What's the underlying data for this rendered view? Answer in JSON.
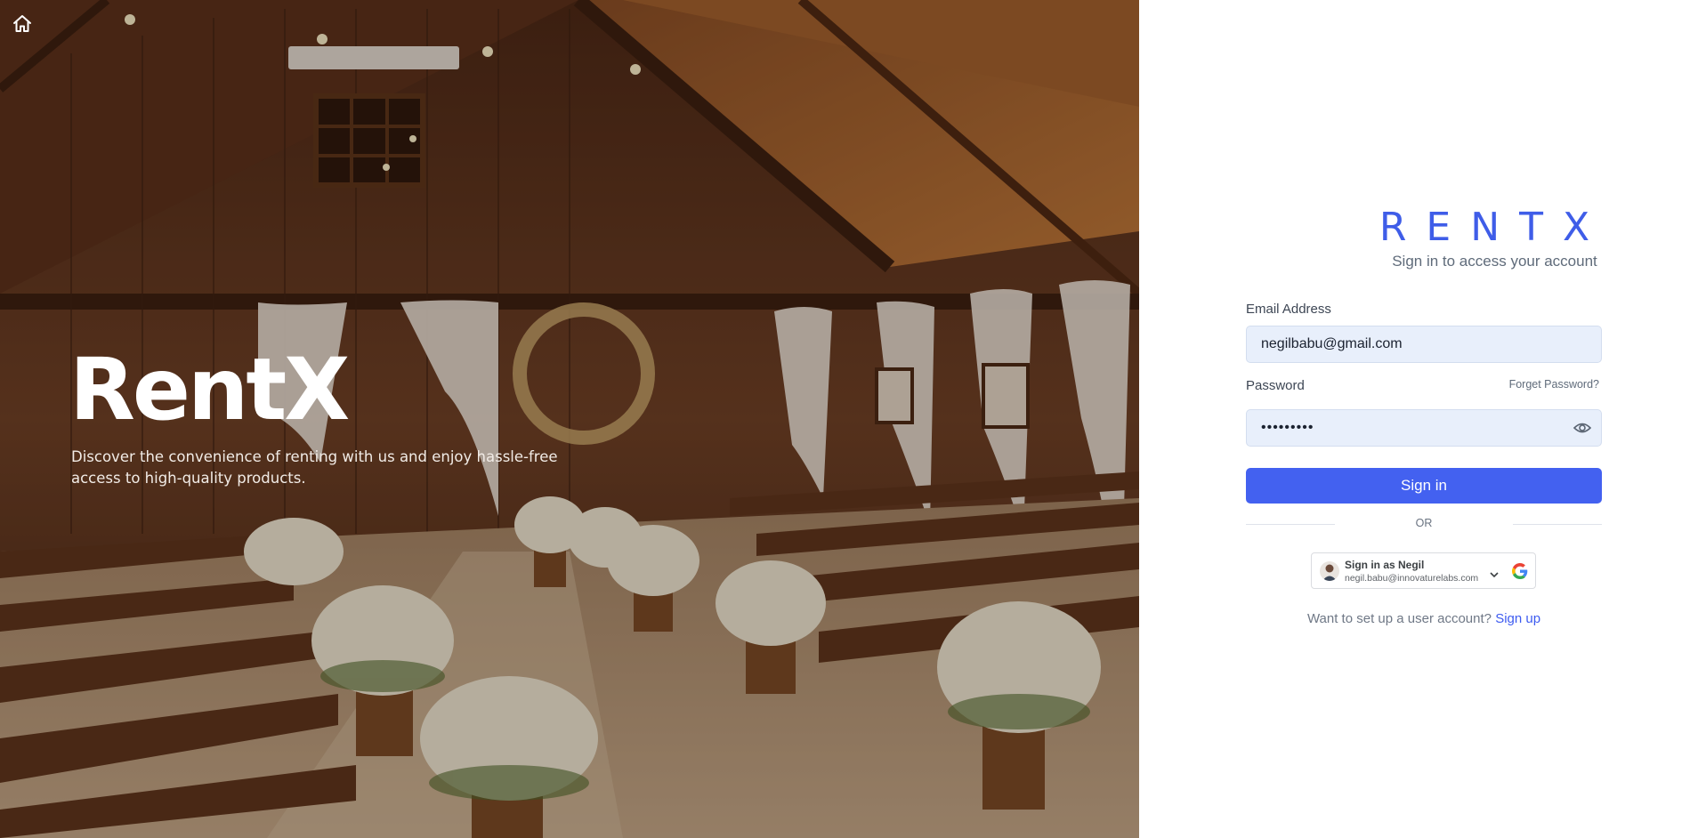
{
  "hero": {
    "title": "RentX",
    "tagline": "Discover the convenience of renting with us and enjoy hassle-free access to high-quality products."
  },
  "nav": {
    "home_icon": "home-icon"
  },
  "brand": {
    "logo_text": "RENTX",
    "subtitle": "Sign in to access your account"
  },
  "form": {
    "email_label": "Email Address",
    "email_value": "negilbabu@gmail.com",
    "password_label": "Password",
    "forgot_label": "Forget Password?",
    "password_value": "•••••••••",
    "show_password_icon": "eye-icon",
    "signin_label": "Sign in",
    "or_label": "OR"
  },
  "google": {
    "name_label": "Sign in as Negil",
    "email": "negil.babu@innovaturelabs.com",
    "logo_icon": "google-logo-icon",
    "chevron_icon": "chevron-down-icon"
  },
  "signup": {
    "prompt": "Want to set up a user account?",
    "link_label": "Sign up"
  },
  "colors": {
    "accent": "#4361f0",
    "brand_logo": "#3f5de8",
    "input_bg": "#e8effb",
    "link": "#3d5bf0"
  }
}
